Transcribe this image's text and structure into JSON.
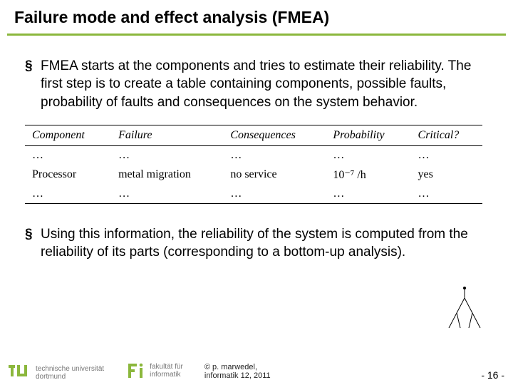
{
  "title": "Failure mode and effect analysis (FMEA)",
  "bullets": {
    "intro": "FMEA starts at the components and tries to estimate their reliability. The first step is to create a table containing components, possible faults, probability of faults and consequences on the system behavior.",
    "summary": "Using this information, the reliability of the system is computed from the reliability of its parts (corresponding to a bottom-up analysis)."
  },
  "table": {
    "headers": {
      "component": "Component",
      "failure": "Failure",
      "consequences": "Consequences",
      "probability": "Probability",
      "critical": "Critical?"
    },
    "rows": [
      {
        "component": "…",
        "failure": "…",
        "consequences": "…",
        "probability": "…",
        "critical": "…"
      },
      {
        "component": "Processor",
        "failure": "metal migration",
        "consequences": "no service",
        "probability": "10⁻⁷ /h",
        "critical": "yes"
      },
      {
        "component": "…",
        "failure": "…",
        "consequences": "…",
        "probability": "…",
        "critical": "…"
      }
    ]
  },
  "footer": {
    "university_line1": "technische universität",
    "university_line2": "dortmund",
    "faculty_line1": "fakultät für",
    "faculty_line2": "informatik",
    "copyright_line1": "© p. marwedel,",
    "copyright_line2": "informatik 12, 2011",
    "page": "- 16 -"
  }
}
